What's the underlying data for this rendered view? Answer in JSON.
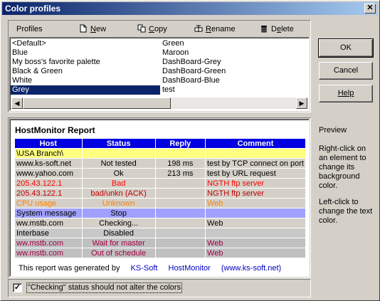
{
  "window": {
    "title": "Color profiles",
    "close_glyph": "✕"
  },
  "toolbar": {
    "label": "Profiles",
    "new": {
      "u": "N",
      "rest": "ew"
    },
    "copy": {
      "u": "C",
      "rest": "opy"
    },
    "rename": {
      "u": "R",
      "rest": "ename"
    },
    "delete": {
      "pre": "D",
      "u": "e",
      "rest": "lete"
    }
  },
  "profiles": {
    "col1": [
      "<Default>",
      "Blue",
      "My boss's favorite palette",
      "Black & Green",
      "White",
      "Grey"
    ],
    "col2": [
      "Green",
      "Maroon",
      "DashBoard-Grey",
      "DashBoard-Green",
      "DashBoard-Blue",
      "test"
    ],
    "selected": "Grey"
  },
  "buttons": {
    "ok": "OK",
    "cancel": "Cancel",
    "help": "Help"
  },
  "report": {
    "title": "HostMonitor Report",
    "headers": [
      "Host",
      "Status",
      "Reply",
      "Comment"
    ],
    "rows": [
      {
        "cells": [
          "\\USA Branch\\",
          "",
          "",
          ""
        ],
        "bg": "#ffff80",
        "fg": "#000000"
      },
      {
        "cells": [
          "www.ks-soft.net",
          "Not tested",
          "198 ms",
          "test by TCP connect on port"
        ],
        "bg": "#d4d0c8",
        "fg": "#000000"
      },
      {
        "cells": [
          "www.yahoo.com",
          "Ok",
          "213 ms",
          "test by URL request"
        ],
        "bg": "#d4d0c8",
        "fg": "#000000"
      },
      {
        "cells": [
          "205.43.122.1",
          "Bad",
          "",
          "NGTH ftp server"
        ],
        "bg": "#d4d0c8",
        "fg": "#ff0000"
      },
      {
        "cells": [
          "205.43.122.1",
          "bad/unkn  (ACK)",
          "",
          "NGTH ftp server"
        ],
        "bg": "#d4d0c8",
        "fg": "#c00000"
      },
      {
        "cells": [
          "CPU usage",
          "Unknown",
          "",
          "Web"
        ],
        "bg": "#d4d0c8",
        "fg": "#ff8000"
      },
      {
        "cells": [
          "System message",
          "Stop",
          "",
          ""
        ],
        "bg": "#a0a0ff",
        "fg": "#000000"
      },
      {
        "cells": [
          "ww.mstb.com",
          "Checking...",
          "",
          "Web"
        ],
        "bg": "#d4d0c8",
        "fg": "#000000"
      },
      {
        "cells": [
          "Interbase",
          "Disabled",
          "",
          ""
        ],
        "bg": "#c8c8c8",
        "fg": "#000000"
      },
      {
        "cells": [
          "ww.mstb.com",
          "Wait for master",
          "",
          "Web"
        ],
        "bg": "#c0c0c0",
        "fg": "#a00040"
      },
      {
        "cells": [
          "ww.mstb.com",
          "Out of schedule",
          "",
          "Web"
        ],
        "bg": "#c0c0c0",
        "fg": "#a00040"
      }
    ],
    "footer": {
      "text": "This report was generated by",
      "vendor": "KS-Soft",
      "product": "HostMonitor",
      "url": "(www.ks-soft.net)",
      "link_color": "#0000c0"
    }
  },
  "side": {
    "label": "Preview",
    "hint1": "Right-click on an element to change its background color.",
    "hint2": "Left-click to change the text color."
  },
  "checkbox": {
    "checked_glyph": "✓",
    "label": "\"Checking\" status should not alter the colors"
  },
  "scroll": {
    "left_glyph": "◀",
    "right_glyph": "▶"
  }
}
